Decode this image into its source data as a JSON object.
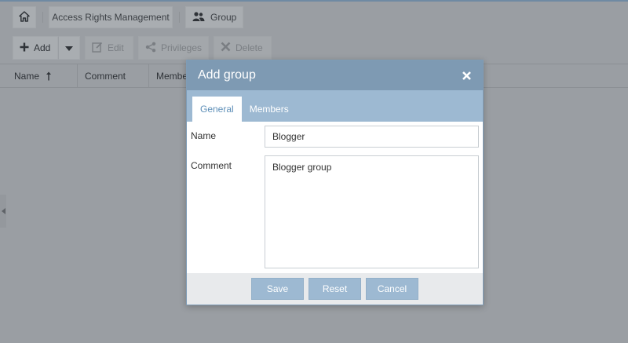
{
  "breadcrumb": {
    "home_icon": "home-icon",
    "section": "Access Rights Management",
    "current": "Group",
    "current_icon": "users-icon"
  },
  "toolbar": {
    "add_label": "Add",
    "edit_label": "Edit",
    "privileges_label": "Privileges",
    "delete_label": "Delete"
  },
  "grid": {
    "columns": [
      "Name",
      "Comment",
      "Members"
    ],
    "sort_column": "Name",
    "sort_direction": "ascending"
  },
  "dialog": {
    "title": "Add group",
    "tabs": [
      "General",
      "Members"
    ],
    "active_tab": "General",
    "fields": {
      "name_label": "Name",
      "name_value": "Blogger",
      "comment_label": "Comment",
      "comment_value": "Blogger group"
    },
    "buttons": {
      "save": "Save",
      "reset": "Reset",
      "cancel": "Cancel"
    }
  },
  "colors": {
    "dialog_header": "#7e9ab3",
    "tab_bar": "#9db9d2",
    "active_tab_text": "#5e8fb8",
    "button": "#9db9d2",
    "overlay": "#9a9ea3"
  }
}
